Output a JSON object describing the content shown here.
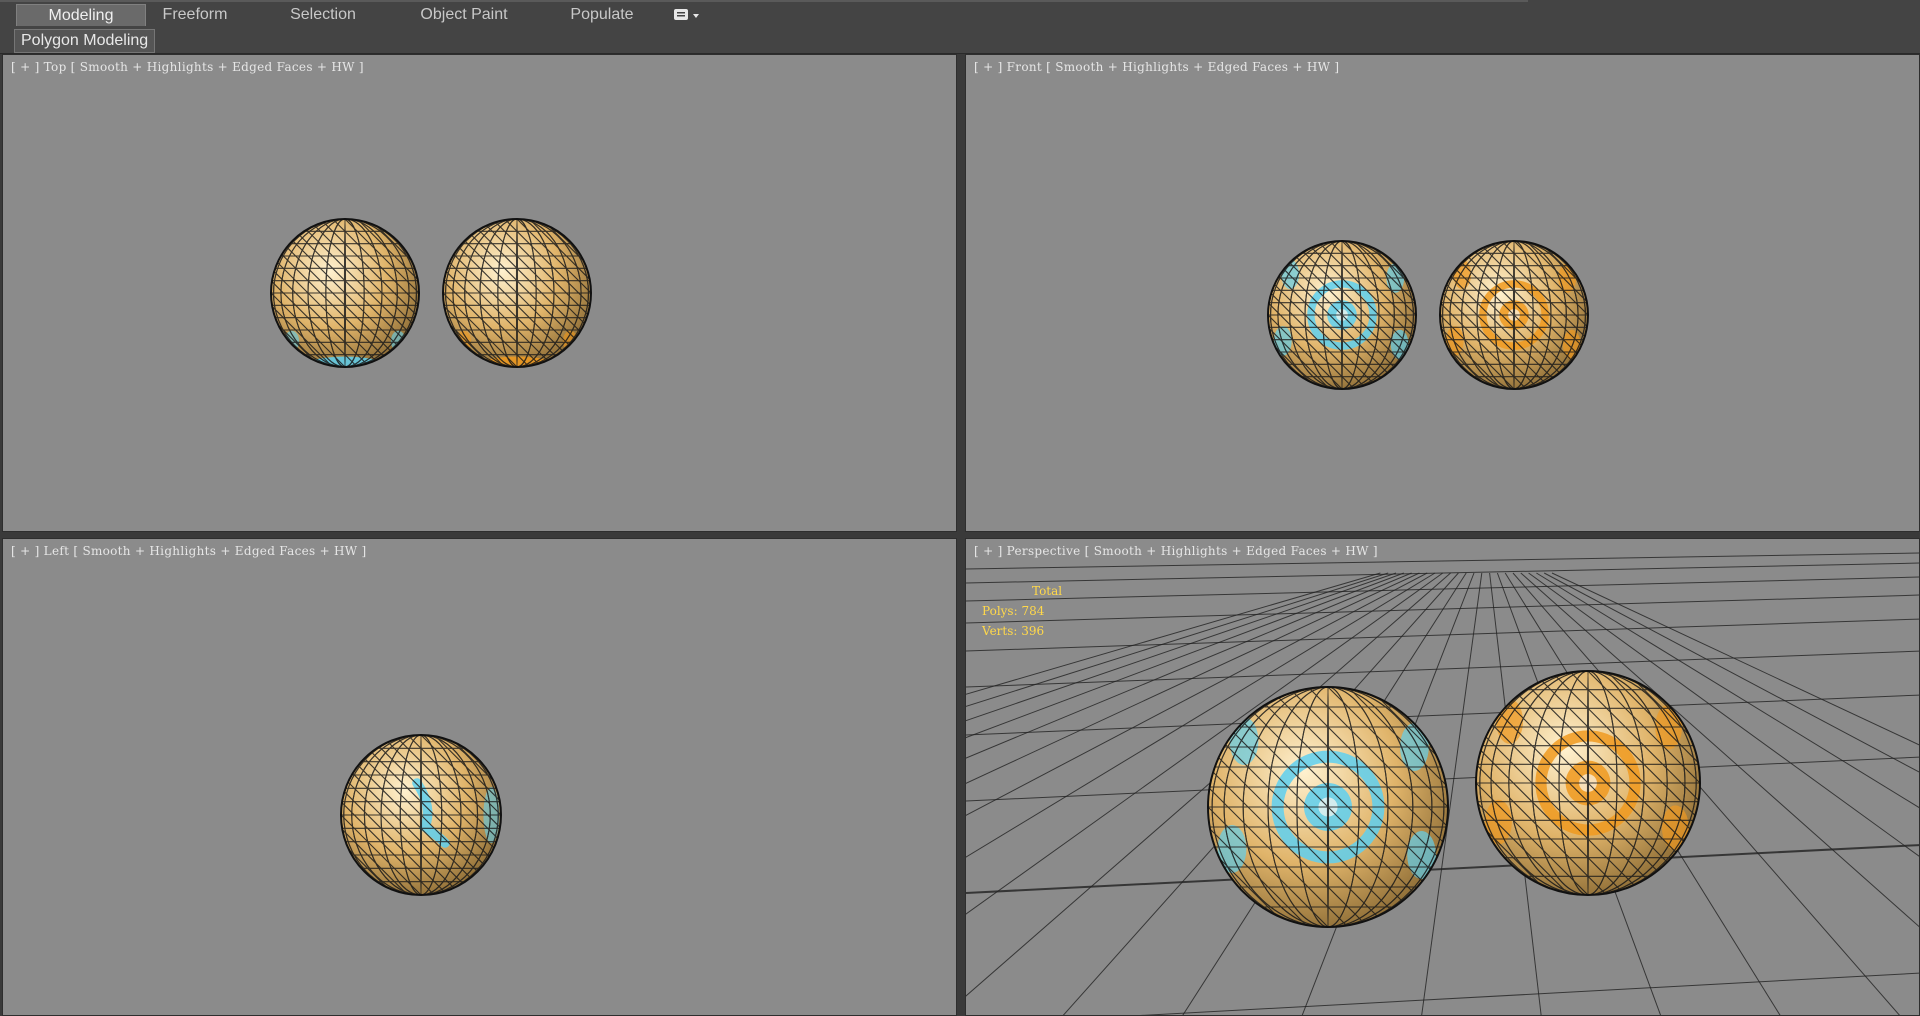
{
  "ribbon": {
    "tabs": [
      {
        "label": "Modeling",
        "active": true
      },
      {
        "label": "Freeform",
        "active": false
      },
      {
        "label": "Selection",
        "active": false
      },
      {
        "label": "Object Paint",
        "active": false
      },
      {
        "label": "Populate",
        "active": false
      }
    ],
    "menu_icon": "ribbon-options-icon"
  },
  "subbar": {
    "panel_label": "Polygon Modeling"
  },
  "viewports": {
    "top": {
      "plus": "[ + ]",
      "view": "Top",
      "shading": "Smooth + Highlights + Edged Faces + HW ]"
    },
    "front": {
      "plus": "[ + ]",
      "view": "Front",
      "shading": "Smooth + Highlights + Edged Faces + HW ]"
    },
    "left": {
      "plus": "[ + ]",
      "view": "Left",
      "shading": "Smooth + Highlights + Edged Faces + HW ]"
    },
    "perspective": {
      "plus": "[ + ]",
      "view": "Perspective",
      "shading": "Smooth + Highlights + Edged Faces + HW ]"
    }
  },
  "stats": {
    "title": "Total",
    "polys_label": "Polys:",
    "polys": "784",
    "verts_label": "Verts:",
    "verts": "396"
  },
  "colors": {
    "viewport_bg": "#8b8b8b",
    "sphere_gold": "#e0b46a",
    "sphere_blue_accent": "#5fd0f0",
    "sphere_orange_accent": "#f09a20",
    "stats_text": "#ffd84a"
  }
}
